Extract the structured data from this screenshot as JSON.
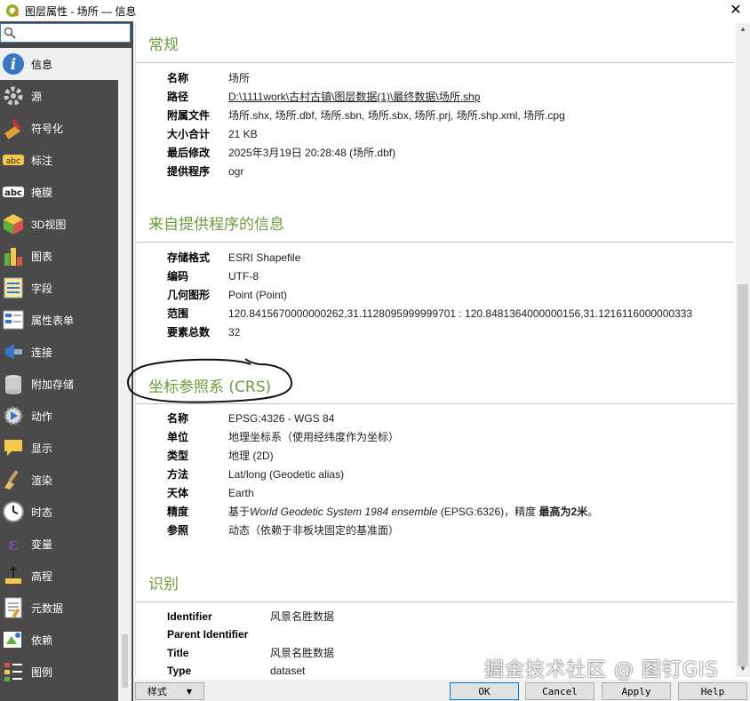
{
  "window": {
    "title": "图层属性 - 场所 — 信息",
    "close": "✕"
  },
  "search": {
    "value": ""
  },
  "nav": [
    {
      "label": "信息",
      "icon": "info-icon",
      "active": true
    },
    {
      "label": "源",
      "icon": "source-icon"
    },
    {
      "label": "符号化",
      "icon": "symbology-icon"
    },
    {
      "label": "标注",
      "icon": "labels-icon"
    },
    {
      "label": "掩膜",
      "icon": "mask-icon"
    },
    {
      "label": "3D视图",
      "icon": "3d-view-icon"
    },
    {
      "label": "图表",
      "icon": "diagram-icon"
    },
    {
      "label": "字段",
      "icon": "fields-icon"
    },
    {
      "label": "属性表单",
      "icon": "attributes-form-icon"
    },
    {
      "label": "连接",
      "icon": "joins-icon"
    },
    {
      "label": "附加存储",
      "icon": "auxiliary-storage-icon"
    },
    {
      "label": "动作",
      "icon": "actions-icon"
    },
    {
      "label": "显示",
      "icon": "display-icon"
    },
    {
      "label": "渲染",
      "icon": "rendering-icon"
    },
    {
      "label": "时态",
      "icon": "temporal-icon"
    },
    {
      "label": "变量",
      "icon": "variables-icon"
    },
    {
      "label": "高程",
      "icon": "elevation-icon"
    },
    {
      "label": "元数据",
      "icon": "metadata-icon"
    },
    {
      "label": "依赖",
      "icon": "dependencies-icon"
    },
    {
      "label": "图例",
      "icon": "legend-icon"
    }
  ],
  "sections": {
    "general": {
      "title": "常规",
      "rows": [
        {
          "k": "名称",
          "v": "场所"
        },
        {
          "k": "路径",
          "v": "D:\\1111work\\古村古镇\\图层数据(1)\\最终数据\\场所.shp"
        },
        {
          "k": "附属文件",
          "v": "场所.shx, 场所.dbf, 场所.sbn, 场所.sbx, 场所.prj, 场所.shp.xml, 场所.cpg"
        },
        {
          "k": "大小合计",
          "v": "21 KB"
        },
        {
          "k": "最后修改",
          "v": "2025年3月19日 20:28:48 (场所.dbf)"
        },
        {
          "k": "提供程序",
          "v": "ogr"
        }
      ]
    },
    "provider": {
      "title": "来自提供程序的信息",
      "rows": [
        {
          "k": "存储格式",
          "v": "ESRI Shapefile"
        },
        {
          "k": "编码",
          "v": "UTF-8"
        },
        {
          "k": "几何图形",
          "v": "Point (Point)"
        },
        {
          "k": "范围",
          "v": "120.8415670000000262,31.1128095999999701 : 120.8481364000000156,31.1216116000000333"
        },
        {
          "k": "要素总数",
          "v": "32"
        }
      ]
    },
    "crs": {
      "title": "坐标参照系 (CRS)",
      "rows": [
        {
          "k": "名称",
          "v": "EPSG:4326 - WGS 84"
        },
        {
          "k": "单位",
          "v": "地理坐标系（使用经纬度作为坐标）"
        },
        {
          "k": "类型",
          "v": "地理 (2D)"
        },
        {
          "k": "方法",
          "v": "Lat/long (Geodetic alias)"
        },
        {
          "k": "天体",
          "v": "Earth"
        },
        {
          "k": "精度",
          "v_pre": "基于",
          "v_italic": "World Geodetic System 1984 ensemble",
          "v_mid": " (EPSG:6326)，精度 ",
          "v_bold": "最高为2米",
          "v_post": "。"
        },
        {
          "k": "参照",
          "v": "动态（依赖于非板块固定的基准面）"
        }
      ]
    },
    "identification": {
      "title": "识别",
      "rows": [
        {
          "k": "Identifier",
          "v": "风景名胜数据"
        },
        {
          "k": "Parent Identifier",
          "v": ""
        },
        {
          "k": "Title",
          "v": "风景名胜数据"
        },
        {
          "k": "Type",
          "v": "dataset"
        }
      ]
    }
  },
  "buttons": {
    "style": "样式",
    "ok": "OK",
    "cancel": "Cancel",
    "apply": "Apply",
    "help": "Help"
  },
  "watermark": "掘金技术社区 @ 图钉GIS",
  "colors": {
    "section_title": "#6f9c3f",
    "sidebar_bg": "#4a4a4a",
    "link": "#2a6db5"
  }
}
